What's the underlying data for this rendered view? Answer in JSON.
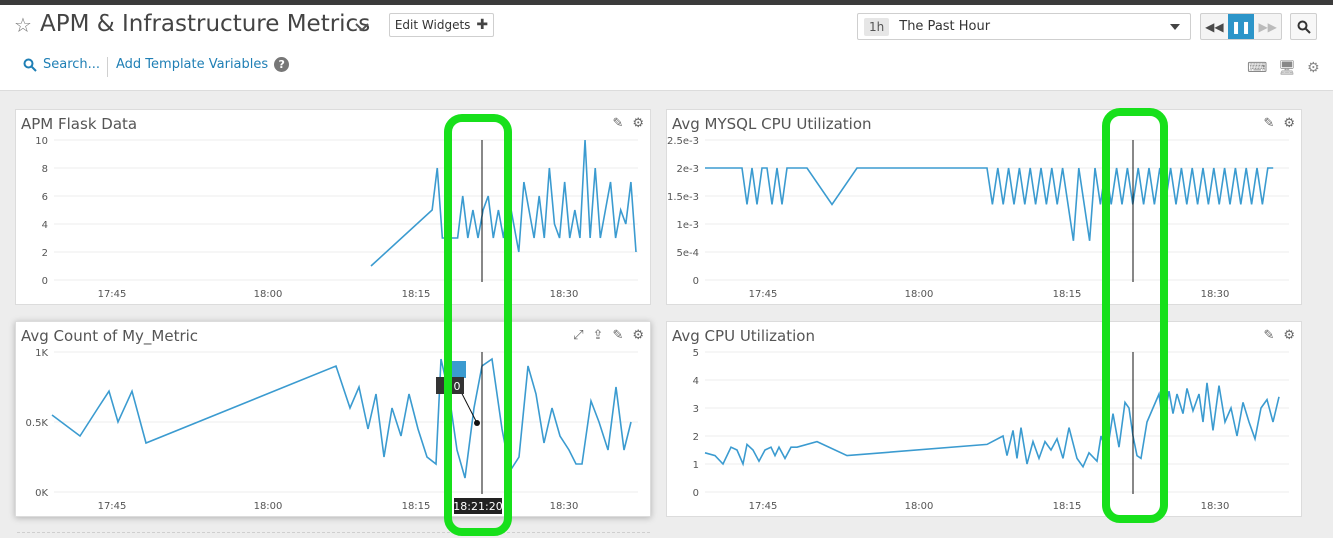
{
  "header": {
    "title": "APM & Infrastructure Metrics",
    "edit_widgets": "Edit Widgets",
    "time_badge": "1h",
    "time_label": "The Past Hour",
    "search_label": "Search...",
    "add_template_vars": "Add Template Variables",
    "help_glyph": "?"
  },
  "colors": {
    "accent": "#2c95c9",
    "series": "#3b9bd0",
    "highlight": "#17e01b",
    "link": "#1f7fb5"
  },
  "icons": [
    "star-icon",
    "chevron-down-icon",
    "plus-icon",
    "caret-down-icon",
    "rewind-icon",
    "pause-icon",
    "fast-forward-icon",
    "zoom-icon",
    "search-icon",
    "help-icon",
    "keyboard-icon",
    "monitor-icon",
    "gear-icon",
    "pencil-icon",
    "expand-icon",
    "share-icon"
  ],
  "widgets": [
    {
      "title": "APM Flask Data",
      "chart_data": {
        "type": "line",
        "x_ticks": [
          "17:45",
          "18:00",
          "18:15",
          "18:30"
        ],
        "y_ticks": [
          "0",
          "2",
          "4",
          "6",
          "8",
          "10"
        ],
        "ylim": [
          0,
          10
        ],
        "xlim_minutes": [
          1730,
          1838
        ],
        "series": [
          {
            "values": [
              [
                1810,
                1
              ],
              [
                1822,
                5
              ],
              [
                1823,
                8
              ],
              [
                1824,
                3
              ],
              [
                1827,
                3
              ],
              [
                1828,
                6
              ],
              [
                1829,
                3
              ],
              [
                1830,
                5
              ],
              [
                1831,
                3
              ],
              [
                1832,
                5
              ],
              [
                1833,
                6
              ],
              [
                1834,
                3
              ],
              [
                1835,
                5
              ],
              [
                1836,
                3
              ],
              [
                1837,
                6
              ],
              [
                1838,
                4
              ],
              [
                1839,
                2
              ],
              [
                1840,
                7
              ],
              [
                1841,
                5
              ],
              [
                1842,
                3
              ],
              [
                1843,
                6
              ],
              [
                1844,
                3
              ],
              [
                1845,
                8
              ],
              [
                1846,
                4
              ],
              [
                1847,
                3
              ],
              [
                1848,
                7
              ],
              [
                1849,
                3
              ],
              [
                1850,
                5
              ],
              [
                1851,
                3
              ],
              [
                1852,
                10
              ],
              [
                1853,
                3
              ],
              [
                1854,
                8
              ],
              [
                1855,
                3
              ],
              [
                1856,
                5
              ],
              [
                1857,
                7
              ],
              [
                1858,
                3
              ],
              [
                1859,
                5
              ],
              [
                1860,
                4
              ],
              [
                1861,
                7
              ],
              [
                1862,
                2
              ]
            ]
          }
        ]
      }
    },
    {
      "title": "Avg MYSQL CPU Utilization",
      "chart_data": {
        "type": "line",
        "x_ticks": [
          "17:45",
          "18:00",
          "18:15",
          "18:30"
        ],
        "y_ticks": [
          "0",
          "5e-4",
          "1e-3",
          "1.5e-3",
          "2e-3",
          "2.5e-3"
        ],
        "ylim": [
          0,
          0.0025
        ]
      }
    },
    {
      "title": "Avg Count of My_Metric",
      "chart_data": {
        "type": "line",
        "x_ticks": [
          "17:45",
          "18:00",
          "18:15",
          "18:30"
        ],
        "y_ticks": [
          "0K",
          "0.5K",
          "1K"
        ],
        "ylim": [
          0,
          1000
        ]
      },
      "cursor_time": "18:21:20",
      "tooltip_text": "0"
    },
    {
      "title": "Avg CPU Utilization",
      "chart_data": {
        "type": "line",
        "x_ticks": [
          "17:45",
          "18:00",
          "18:15",
          "18:30"
        ],
        "y_ticks": [
          "0",
          "1",
          "2",
          "3",
          "4",
          "5"
        ],
        "ylim": [
          0,
          5
        ]
      }
    }
  ]
}
